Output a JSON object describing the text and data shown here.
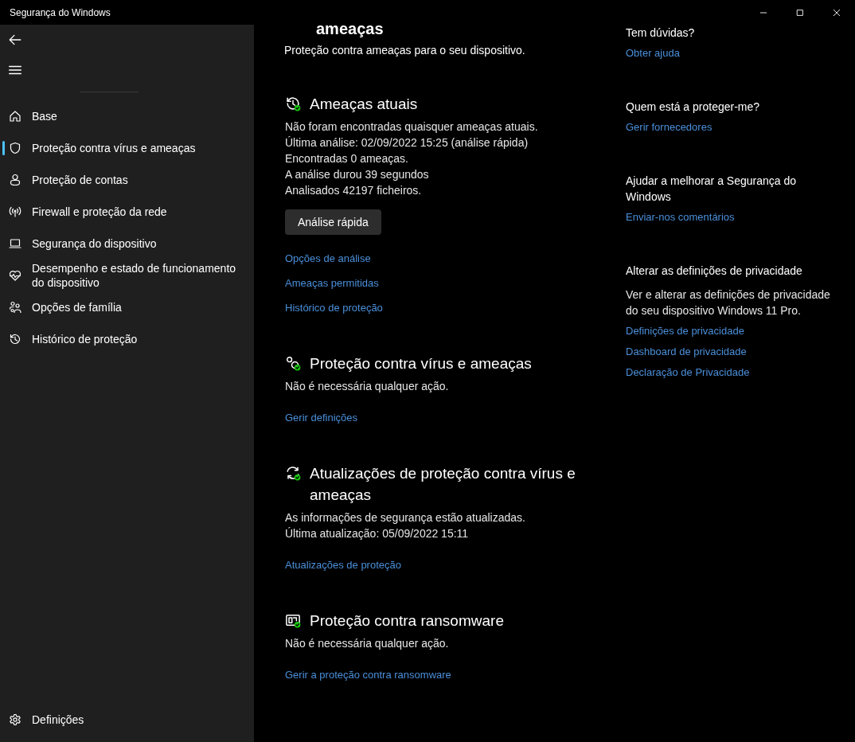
{
  "window": {
    "title": "Segurança do Windows"
  },
  "sidebar": {
    "items": [
      {
        "label": "Base",
        "selected": false
      },
      {
        "label": "Proteção contra vírus e ameaças",
        "selected": true
      },
      {
        "label": "Proteção de contas",
        "selected": false
      },
      {
        "label": "Firewall e proteção da rede",
        "selected": false
      },
      {
        "label": "Segurança do dispositivo",
        "selected": false
      },
      {
        "label": "Desempenho e estado de funcionamento do dispositivo",
        "selected": false
      },
      {
        "label": "Opções de família",
        "selected": false
      },
      {
        "label": "Histórico de proteção",
        "selected": false
      }
    ],
    "footer": {
      "label": "Definições"
    }
  },
  "main": {
    "page_title": "ameaças",
    "subtitle": "Proteção contra ameaças para o seu dispositivo.",
    "sections": [
      {
        "title": "Ameaças atuais",
        "lines": [
          "Não foram encontradas quaisquer ameaças atuais.",
          "Última análise: 02/09/2022 15:25 (análise rápida)",
          "Encontradas 0 ameaças.",
          "A análise durou 39 segundos",
          "Analisados 42197 ficheiros."
        ],
        "button": "Análise rápida",
        "links": [
          "Opções de análise",
          "Ameaças permitidas",
          "Histórico de proteção"
        ]
      },
      {
        "title": "Proteção contra vírus e ameaças",
        "lines": [
          "Não é necessária qualquer ação."
        ],
        "links": [
          "Gerir definições"
        ]
      },
      {
        "title": "Atualizações de proteção contra vírus e ameaças",
        "lines": [
          "As informações de segurança estão atualizadas.",
          "Última atualização: 05/09/2022 15:11"
        ],
        "links": [
          "Atualizações de proteção"
        ]
      },
      {
        "title": "Proteção contra ransomware",
        "lines": [
          "Não é necessária qualquer ação."
        ],
        "links": [
          "Gerir a proteção contra ransomware"
        ]
      }
    ]
  },
  "aside": {
    "sections": [
      {
        "title": "Tem dúvidas?",
        "links": [
          "Obter ajuda"
        ]
      },
      {
        "title": "Quem está a proteger-me?",
        "links": [
          "Gerir fornecedores"
        ]
      },
      {
        "title": "Ajudar a melhorar a Segurança do Windows",
        "links": [
          "Enviar-nos comentários"
        ]
      },
      {
        "title": "Alterar as definições de privacidade",
        "text": "Ver e alterar as definições de privacidade do seu dispositivo Windows 11 Pro.",
        "links": [
          "Definições de privacidade",
          "Dashboard de privacidade",
          "Declaração de Privacidade"
        ]
      }
    ]
  }
}
